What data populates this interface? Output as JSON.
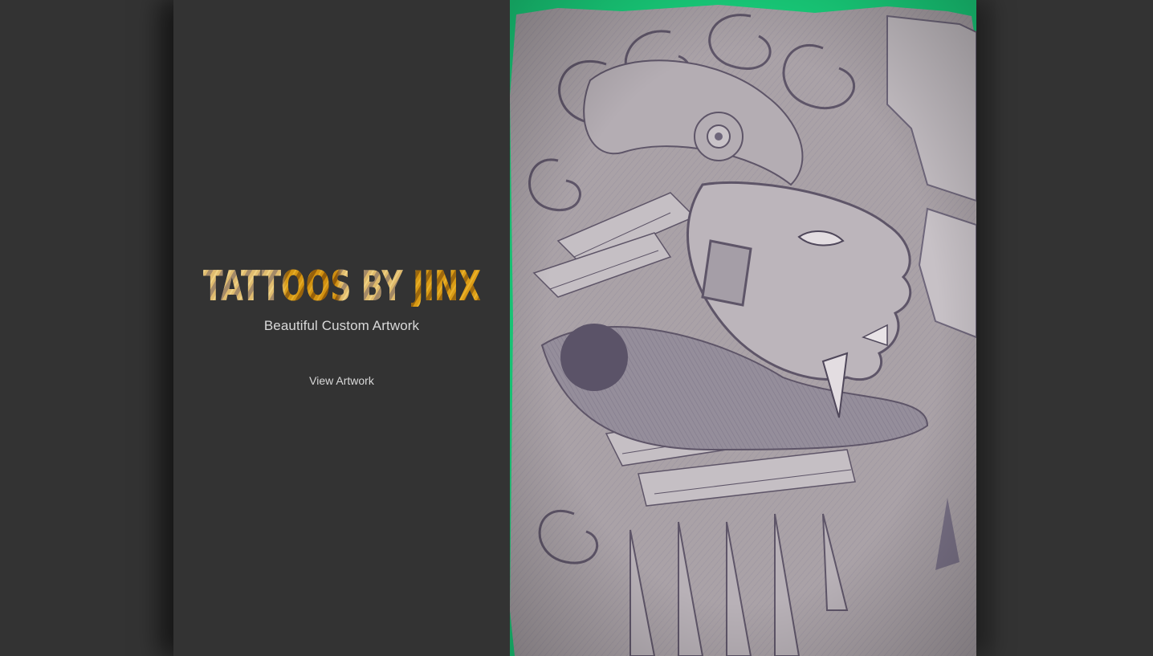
{
  "hero": {
    "logo_text": "TATTOOS BY JINX",
    "tagline": "Beautiful Custom Artwork",
    "cta_label": "View Artwork"
  },
  "artwork": {
    "subject": "pencil sketch of an Aztec warrior head in a serpent headdress",
    "icon": "artwork-image"
  },
  "colors": {
    "background": "#333333",
    "text": "#d9d9d9",
    "logo_fill_light": "#e9e4dc",
    "logo_fill_gold": "#d89a14",
    "sketch_paper": "#a9a1a6",
    "sketch_line": "#5e5568",
    "backdrop_green": "#19d17c"
  }
}
